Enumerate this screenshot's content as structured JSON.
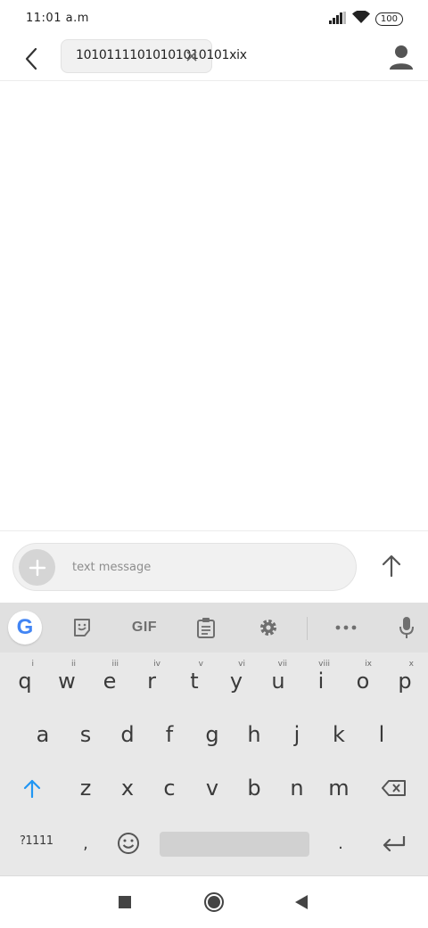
{
  "status_bar": {
    "time": "11:01 a.m",
    "battery": "100"
  },
  "conversation": {
    "recipient_chip": "10101111010101010101xix",
    "icons": {
      "back": "back-arrow-icon",
      "remove": "close-icon",
      "contact": "person-icon"
    }
  },
  "compose": {
    "placeholder": "text message"
  },
  "keyboard": {
    "toolbar": {
      "gif_label": "GIF"
    },
    "row1": [
      {
        "key": "q",
        "hint": "i"
      },
      {
        "key": "w",
        "hint": "ii"
      },
      {
        "key": "e",
        "hint": "iii"
      },
      {
        "key": "r",
        "hint": "iv"
      },
      {
        "key": "t",
        "hint": "v"
      },
      {
        "key": "y",
        "hint": "vi"
      },
      {
        "key": "u",
        "hint": "vii"
      },
      {
        "key": "i",
        "hint": "viii"
      },
      {
        "key": "o",
        "hint": "ix"
      },
      {
        "key": "p",
        "hint": "x"
      }
    ],
    "row2": [
      "a",
      "s",
      "d",
      "f",
      "g",
      "h",
      "j",
      "k",
      "l"
    ],
    "row3": [
      "z",
      "x",
      "c",
      "v",
      "b",
      "n",
      "m"
    ],
    "symbols_label": "?1111",
    "comma": ",",
    "period": "."
  },
  "colors": {
    "accent": "#2196f3",
    "keyboard_bg": "#e8e8e8",
    "toolbar_bg": "#e0e0e0"
  }
}
